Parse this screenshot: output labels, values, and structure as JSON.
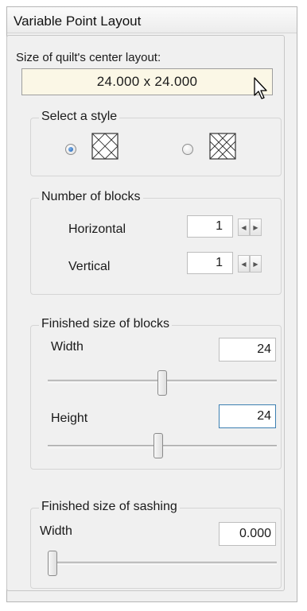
{
  "window": {
    "title": "Variable Point Layout"
  },
  "center_layout": {
    "label": "Size of quilt's center layout:",
    "value": "24.000 x 24.000"
  },
  "style": {
    "legend": "Select a style",
    "options": [
      {
        "name": "style-1",
        "selected": true
      },
      {
        "name": "style-2",
        "selected": false
      }
    ]
  },
  "blocks": {
    "legend": "Number of blocks",
    "horizontal": {
      "label": "Horizontal",
      "value": "1"
    },
    "vertical": {
      "label": "Vertical",
      "value": "1"
    }
  },
  "finished_blocks": {
    "legend": "Finished size of blocks",
    "width": {
      "label": "Width",
      "value": "24",
      "slider_position": 0.5
    },
    "height": {
      "label": "Height",
      "value": "24",
      "slider_position": 0.5
    }
  },
  "sashing": {
    "legend": "Finished size of sashing",
    "width": {
      "label": "Width",
      "value": "0.000",
      "slider_position": 0.0
    }
  },
  "colors": {
    "display_bg": "#fbf7e6",
    "radio_selected": "#1c5fb3",
    "focus_border": "#3c7fb1"
  }
}
